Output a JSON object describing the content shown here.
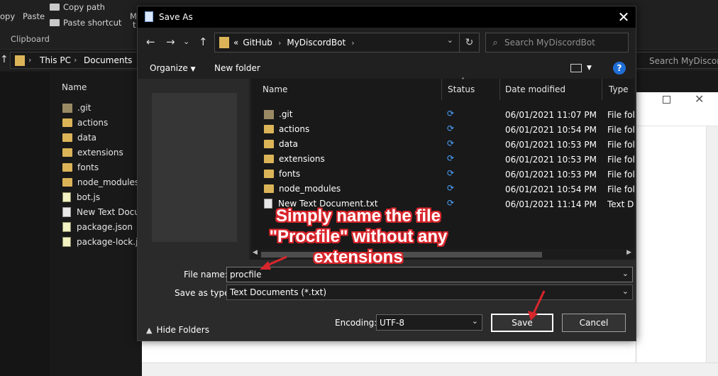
{
  "background": {
    "ribbon": {
      "copy_label": "opy",
      "paste_label": "Paste",
      "copy_path_label": "Copy path",
      "paste_shortcut_label": "Paste shortcut",
      "group_label": "Clipboard",
      "partial_m": "M",
      "partial_t": "t"
    },
    "address": {
      "this_pc": "This PC",
      "documents": "Documents",
      "search_placeholder": "Search MyDiscordA"
    },
    "list_header": "Name",
    "files": [
      {
        "name": ".git",
        "kind": "git"
      },
      {
        "name": "actions",
        "kind": "folder"
      },
      {
        "name": "data",
        "kind": "folder"
      },
      {
        "name": "extensions",
        "kind": "folder"
      },
      {
        "name": "fonts",
        "kind": "folder"
      },
      {
        "name": "node_modules",
        "kind": "folder"
      },
      {
        "name": "bot.js",
        "kind": "js"
      },
      {
        "name": "New Text Docum",
        "kind": "doc"
      },
      {
        "name": "package.json",
        "kind": "js"
      },
      {
        "name": "package-lock.jso",
        "kind": "js"
      }
    ]
  },
  "dialog": {
    "title": "Save As",
    "address": {
      "overflow": "«",
      "crumbs": [
        "GitHub",
        "MyDiscordBot"
      ],
      "search_placeholder": "Search MyDiscordBot"
    },
    "toolbar": {
      "organize_label": "Organize",
      "new_folder_label": "New folder"
    },
    "columns": {
      "name": "Name",
      "status": "Status",
      "date": "Date modified",
      "type": "Type"
    },
    "files": [
      {
        "name": ".git",
        "kind": "git",
        "date": "06/01/2021 11:07 PM",
        "type": "File folder"
      },
      {
        "name": "actions",
        "kind": "folder",
        "date": "06/01/2021 10:54 PM",
        "type": "File folder"
      },
      {
        "name": "data",
        "kind": "folder",
        "date": "06/01/2021 10:53 PM",
        "type": "File folder"
      },
      {
        "name": "extensions",
        "kind": "folder",
        "date": "06/01/2021 10:53 PM",
        "type": "File folder"
      },
      {
        "name": "fonts",
        "kind": "folder",
        "date": "06/01/2021 10:53 PM",
        "type": "File folder"
      },
      {
        "name": "node_modules",
        "kind": "folder",
        "date": "06/01/2021 10:54 PM",
        "type": "File folder"
      },
      {
        "name": "New Text Document.txt",
        "kind": "doc",
        "date": "06/01/2021 11:14 PM",
        "type": "Text Document"
      }
    ],
    "form": {
      "file_name_label": "File name:",
      "file_name_value": "procfile",
      "save_as_type_label": "Save as type:",
      "save_as_type_value": "Text Documents (*.txt)",
      "encoding_label": "Encoding:",
      "encoding_value": "UTF-8",
      "save_label": "Save",
      "cancel_label": "Cancel",
      "hide_folders_label": "Hide Folders"
    }
  },
  "annotation": {
    "lines": [
      "Simply name the file",
      "\"Procfile\" without any",
      "extensions"
    ]
  },
  "colors": {
    "folder": "#dcb458",
    "accent": "#1f6ed6",
    "sync": "#4aa3ff",
    "annotation_red": "#d9262c"
  }
}
